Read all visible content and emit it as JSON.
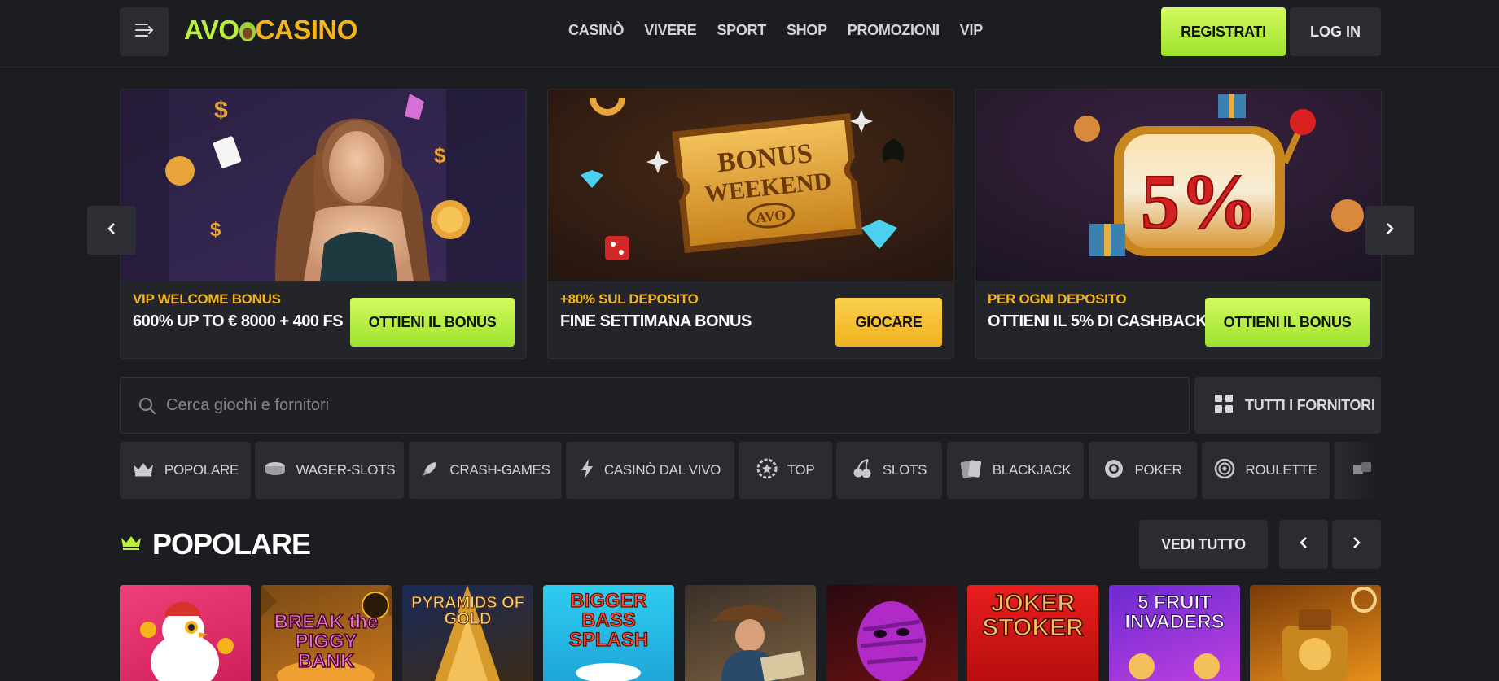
{
  "header": {
    "logo": {
      "part1": "AVO",
      "part2": "CASINO"
    },
    "nav": [
      "CASINÒ",
      "VIVERE",
      "SPORT",
      "SHOP",
      "PROMOZIONI",
      "VIP"
    ],
    "register_label": "REGISTRATI",
    "login_label": "LOG IN"
  },
  "promos": [
    {
      "eyebrow": "VIP WELCOME BONUS",
      "title": "600% UP TO € 8000 + 400 FS",
      "button": "OTTIENI IL BONUS"
    },
    {
      "eyebrow": "+80% SUL DEPOSITO",
      "title": "FINE SETTIMANA BONUS",
      "button": "GIOCARE",
      "art": {
        "line1": "BONUS",
        "line2": "WEEKEND",
        "badge": "AVO"
      }
    },
    {
      "eyebrow": "PER OGNI DEPOSITO",
      "title": "OTTIENI IL 5% DI CASHBACK",
      "button": "OTTIENI IL BONUS",
      "art": {
        "value": "5%"
      }
    }
  ],
  "search": {
    "placeholder": "Cerca giochi e fornitori"
  },
  "providers_label": "TUTTI I FORNITORI",
  "categories": [
    "POPOLARE",
    "WAGER-SLOTS",
    "CRASH-GAMES",
    "CASINÒ DAL VIVO",
    "TOP",
    "SLOTS",
    "BLACKJACK",
    "POKER",
    "ROULETTE"
  ],
  "popular": {
    "title": "POPOLARE",
    "see_all": "VEDI TUTTO",
    "games": [
      {
        "title": ""
      },
      {
        "title": "BREAK the PIGGY BANK"
      },
      {
        "title": "PYRAMIDS OF GOLD"
      },
      {
        "title": "BIGGER BASS SPLASH"
      },
      {
        "title": ""
      },
      {
        "title": ""
      },
      {
        "title": "JOKER STOKER"
      },
      {
        "title": "5 FRUIT INVADERS"
      },
      {
        "title": ""
      }
    ]
  },
  "colors": {
    "accent_green": "#b8f03b",
    "accent_gold": "#f4b41a",
    "background": "#1c1d21",
    "surface": "#2b2c31"
  }
}
